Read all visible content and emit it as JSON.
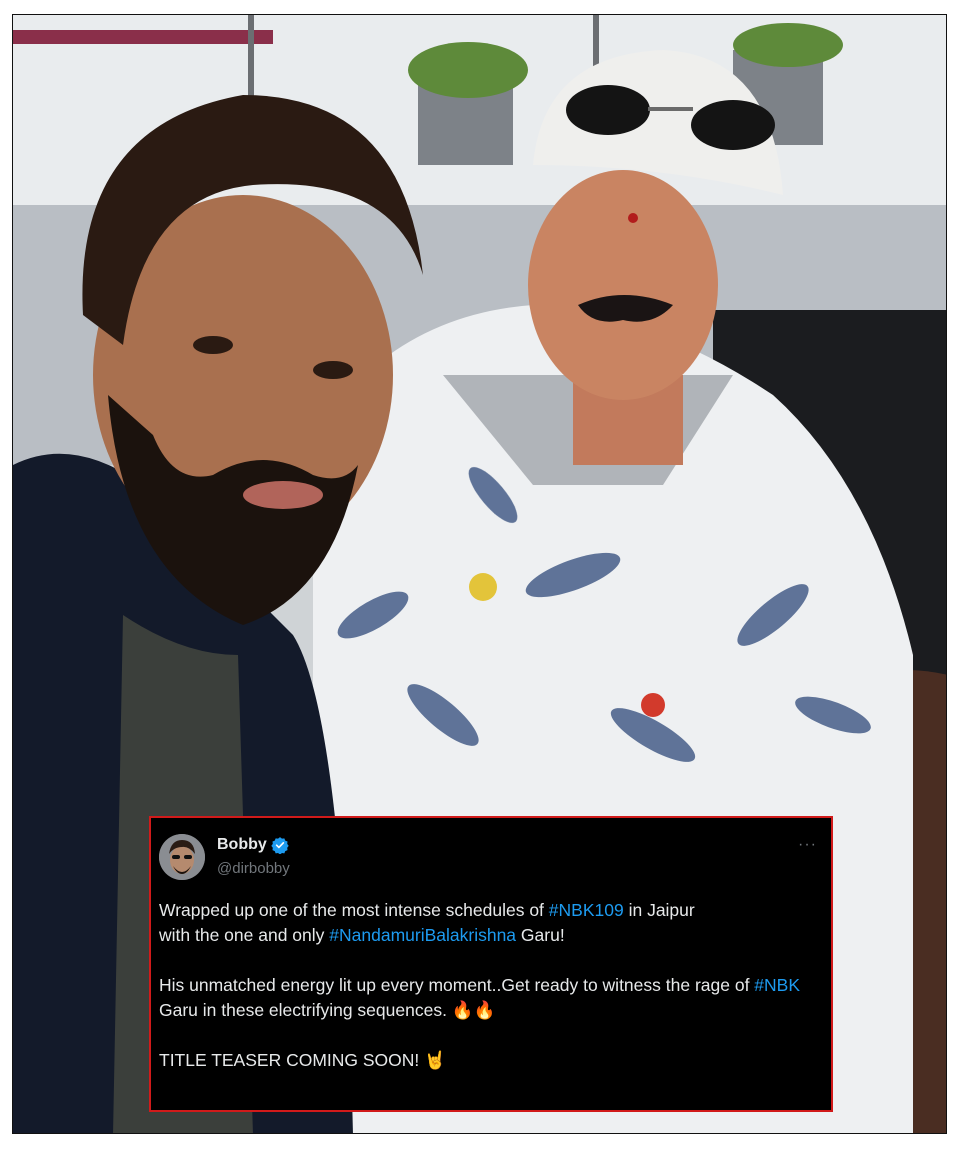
{
  "tweet": {
    "display_name": "Bobby",
    "handle": "@dirbobby",
    "more_label": "···",
    "line1_pre": "Wrapped up one of the most intense schedules of ",
    "line1_tag": "#NBK109",
    "line1_post": " in Jaipur",
    "line2_pre": "with the one and only ",
    "line2_tag": "#NandamuriBalakrishna",
    "line2_post": " Garu!",
    "para2_pre": "His unmatched energy lit up every moment..Get ready to witness the rage of ",
    "para2_tag": "#NBK",
    "para2_post": " Garu in these electrifying sequences. ",
    "para2_emoji": "🔥🔥",
    "para3_text": "TITLE TEASER COMING SOON! ",
    "para3_emoji": "🤘"
  },
  "colors": {
    "card_bg": "#000000",
    "card_border": "#d11a1a",
    "hashtag": "#1d9bf0",
    "verified": "#1d9bf0",
    "muted": "#71767b"
  },
  "icons": [
    "verified-badge-icon",
    "more-options-icon"
  ]
}
